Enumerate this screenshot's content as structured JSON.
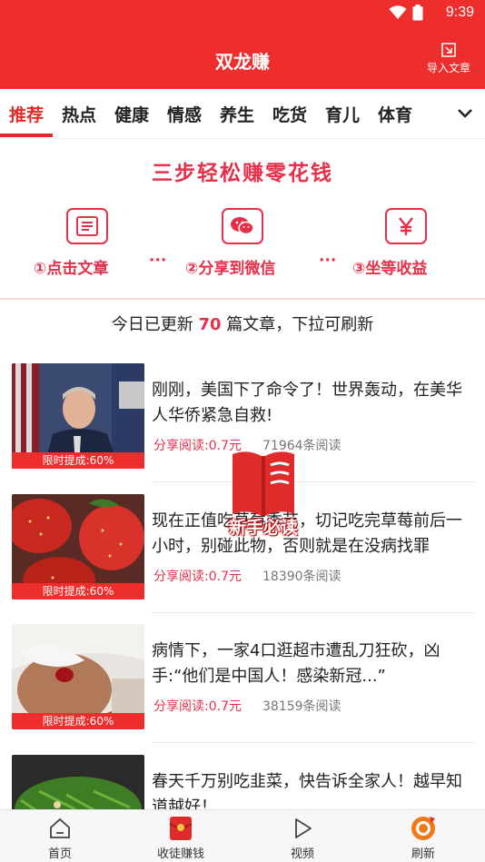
{
  "status_bar": {
    "time": "9:39"
  },
  "header": {
    "title": "双龙赚",
    "import_label": "导入文章"
  },
  "tabs": [
    "推荐",
    "热点",
    "健康",
    "情感",
    "养生",
    "吃货",
    "育儿",
    "体育"
  ],
  "banner": {
    "title": "三步轻松赚零花钱",
    "steps": [
      {
        "label": "①点击文章",
        "icon": "article-icon"
      },
      {
        "label": "②分享到微信",
        "icon": "wechat-icon"
      },
      {
        "label": "③坐等收益",
        "icon": "yuan-icon"
      }
    ],
    "separator": "···"
  },
  "update_note": {
    "prefix": "今日已更新 ",
    "count": "70",
    "suffix": " 篇文章，下拉可刷新"
  },
  "articles": [
    {
      "title": "刚刚，美国下了命令了！世界轰动，在美华人华侨紧急自救!",
      "share": "分享阅读:0.7元",
      "reads": "71964条阅读",
      "badge": "限时提成:60%"
    },
    {
      "title": "现在正值吃草莓季节，切记吃完草莓前后一小时，别碰此物，否则就是在没病找罪",
      "share": "分享阅读:0.7元",
      "reads": "18390条阅读",
      "badge": "限时提成:60%"
    },
    {
      "title": "病情下，一家4口逛超市遭乱刀狂砍，凶手:“他们是中国人！感染新冠...”",
      "share": "分享阅读:0.7元",
      "reads": "38159条阅读",
      "badge": "限时提成:60%"
    },
    {
      "title": "春天千万别吃韭菜，快告诉全家人！越早知道越好！",
      "share": "",
      "reads": "",
      "badge": ""
    }
  ],
  "floating_badge": {
    "label": "新手必读"
  },
  "bottom_nav": [
    {
      "label": "首页",
      "icon": "home-icon"
    },
    {
      "label": "收徒赚钱",
      "icon": "red-envelope-icon"
    },
    {
      "label": "视频",
      "icon": "play-icon"
    },
    {
      "label": "刷新",
      "icon": "refresh-icon"
    }
  ],
  "colors": {
    "brand_red": "#ee2d2d",
    "accent_pink_red": "#e6304a"
  }
}
